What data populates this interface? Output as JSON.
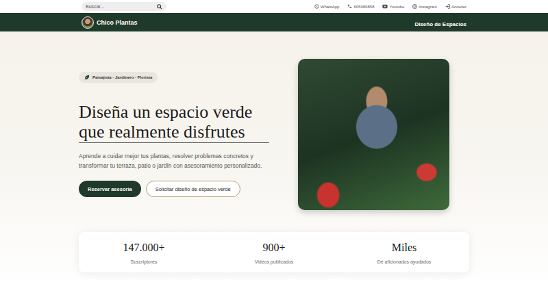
{
  "topbar": {
    "search": {
      "placeholder": "Buscar..."
    },
    "links": [
      {
        "label": "WhatsApp"
      },
      {
        "label": "605089858"
      },
      {
        "label": "Youtube"
      },
      {
        "label": "Instagram"
      },
      {
        "label": "Acceder"
      }
    ]
  },
  "nav": {
    "brand": "Chico Plantas",
    "links": [
      "Diseño de Espacios"
    ]
  },
  "hero": {
    "badge": "Paisajista · Jardinero · Florista",
    "title_lines": [
      "Diseña un espacio verde",
      "que realmente disfrutes"
    ],
    "description": "Aprende a cuidar mejor tus plantas, resolver problemas concretos y transformar tu terraza, patio o jardín con asesoramiento personalizado.",
    "buttons": [
      {
        "label": "Reservar asesoría",
        "kind": "primary"
      },
      {
        "label": "Solicitar diseño de espacio verde",
        "kind": "outline"
      }
    ]
  },
  "stats": [
    {
      "value": "147.000+",
      "label": "Suscriptores"
    },
    {
      "value": "900+",
      "label": "Videos publicados"
    },
    {
      "value": "Miles",
      "label": "De aficionados ayudados"
    }
  ]
}
